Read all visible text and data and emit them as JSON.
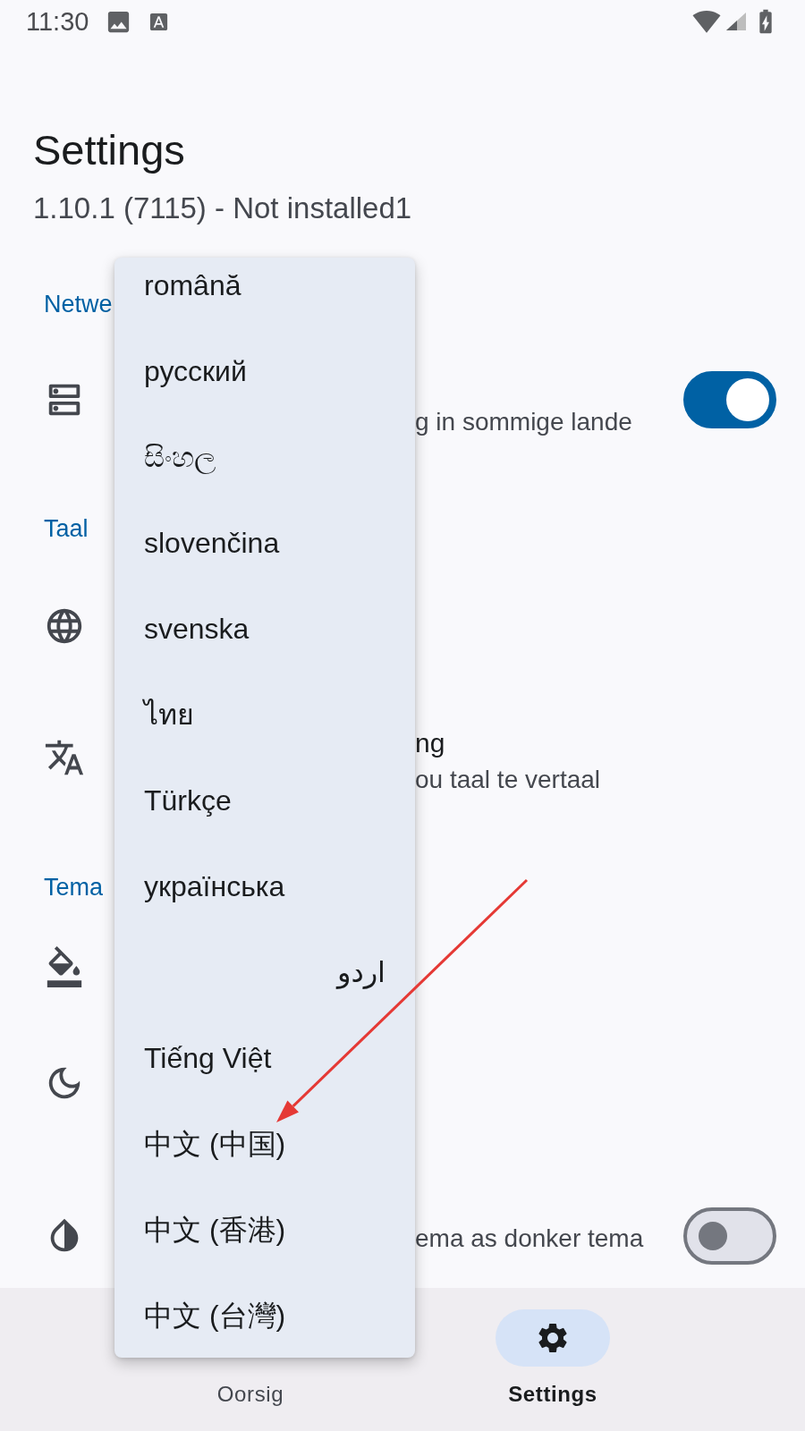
{
  "status_bar": {
    "time": "11:30"
  },
  "header": {
    "title": "Settings",
    "subtitle": "1.10.1 (7115) - Not installed1"
  },
  "sections": [
    {
      "title": "Netwe",
      "rows": [
        {
          "kind": "switch",
          "subtitle": "g in sommige lande",
          "on": true
        }
      ]
    },
    {
      "title": "Taal",
      "rows": [
        {
          "kind": "plain"
        },
        {
          "kind": "plain",
          "title": "ng",
          "subtitle": "ou taal te vertaal"
        }
      ]
    },
    {
      "title": "Tema",
      "rows": [
        {
          "kind": "plain"
        },
        {
          "kind": "plain"
        },
        {
          "kind": "switch",
          "subtitle": "ema as donker tema",
          "on": false
        }
      ]
    }
  ],
  "language_menu": {
    "items": [
      "română",
      "русский",
      "සිංහල",
      "slovenčina",
      "svenska",
      "ไทย",
      "Türkçe",
      "українська",
      "اردو",
      "Tiếng Việt",
      "中文 (中国)",
      "中文 (香港)",
      "中文 (台灣)"
    ]
  },
  "bottom_nav": [
    {
      "label": "Oorsig",
      "selected": false
    },
    {
      "label": "Settings",
      "selected": true
    }
  ]
}
